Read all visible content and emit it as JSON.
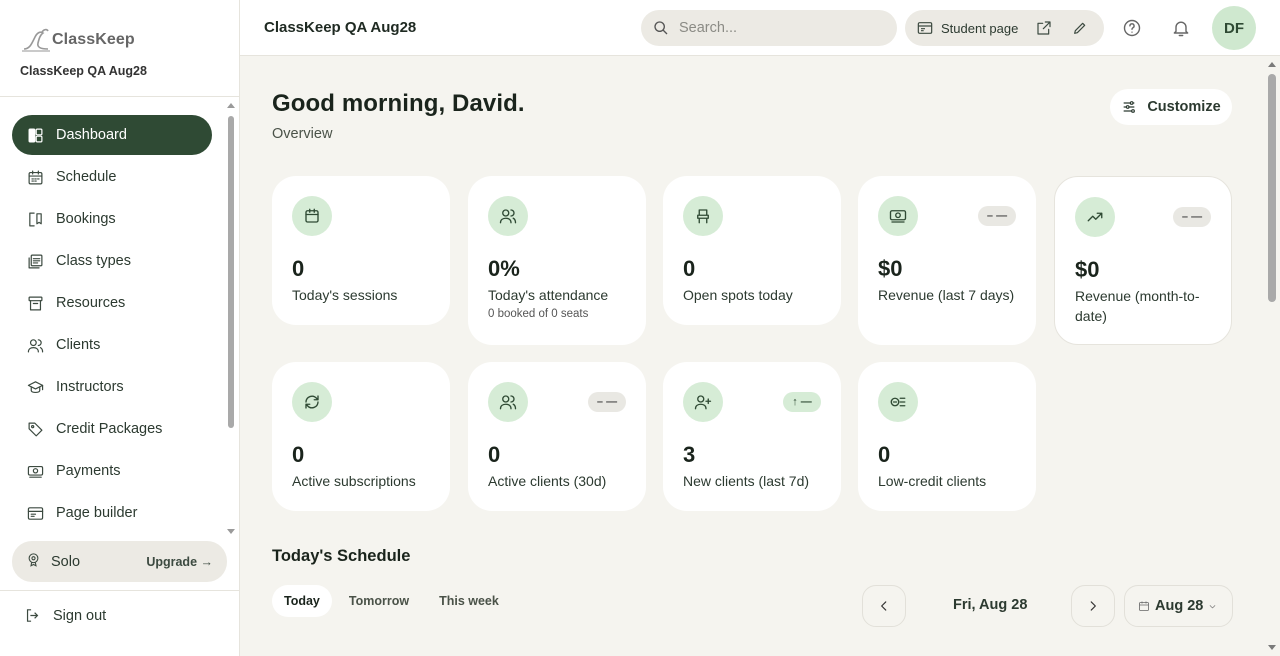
{
  "brand": {
    "name": "ClassKeep",
    "workspace": "ClassKeep QA Aug28"
  },
  "sidebar": {
    "items": [
      {
        "label": "Dashboard",
        "icon": "dashboard-icon"
      },
      {
        "label": "Schedule",
        "icon": "calendar-icon"
      },
      {
        "label": "Bookings",
        "icon": "bookmark-icon"
      },
      {
        "label": "Class types",
        "icon": "list-icon"
      },
      {
        "label": "Resources",
        "icon": "archive-icon"
      },
      {
        "label": "Clients",
        "icon": "users-icon"
      },
      {
        "label": "Instructors",
        "icon": "graduation-icon"
      },
      {
        "label": "Credit Packages",
        "icon": "tag-icon"
      },
      {
        "label": "Payments",
        "icon": "payments-icon"
      },
      {
        "label": "Page builder",
        "icon": "page-icon"
      }
    ],
    "plan": {
      "name": "Solo",
      "upgrade": "Upgrade →"
    },
    "signout": "Sign out"
  },
  "topbar": {
    "title": "ClassKeep QA Aug28",
    "search_placeholder": "Search...",
    "student_page": "Student page",
    "avatar_initials": "DF"
  },
  "main": {
    "greeting": "Good morning, David.",
    "subtitle": "Overview",
    "customize": "Customize",
    "cards": [
      {
        "value": "0",
        "label": "Today's sessions",
        "sub": "",
        "pill": ""
      },
      {
        "value": "0%",
        "label": "Today's attendance",
        "sub": "0 booked of 0 seats",
        "pill": ""
      },
      {
        "value": "0",
        "label": "Open spots today",
        "sub": "",
        "pill": ""
      },
      {
        "value": "$0",
        "label": "Revenue (last 7 days)",
        "sub": "",
        "pill": "– —"
      },
      {
        "value": "$0",
        "label": "Revenue (month-to-date)",
        "sub": "",
        "pill": "– —"
      },
      {
        "value": "0",
        "label": "Active subscriptions",
        "sub": "",
        "pill": ""
      },
      {
        "value": "0",
        "label": "Active clients (30d)",
        "sub": "",
        "pill": "– —"
      },
      {
        "value": "3",
        "label": "New clients (last 7d)",
        "sub": "",
        "pill": "↑ —"
      },
      {
        "value": "0",
        "label": "Low-credit clients",
        "sub": "",
        "pill": ""
      }
    ],
    "schedule": {
      "title": "Today's Schedule",
      "tabs": [
        "Today",
        "Tomorrow",
        "This week"
      ],
      "active_tab": "Today",
      "date_label": "Fri, Aug 28",
      "date_pick": "Aug 28"
    }
  },
  "colors": {
    "accent": "#2f4a34",
    "icon_bg": "#d6ecd6",
    "page_bg": "#f5f4ef"
  }
}
